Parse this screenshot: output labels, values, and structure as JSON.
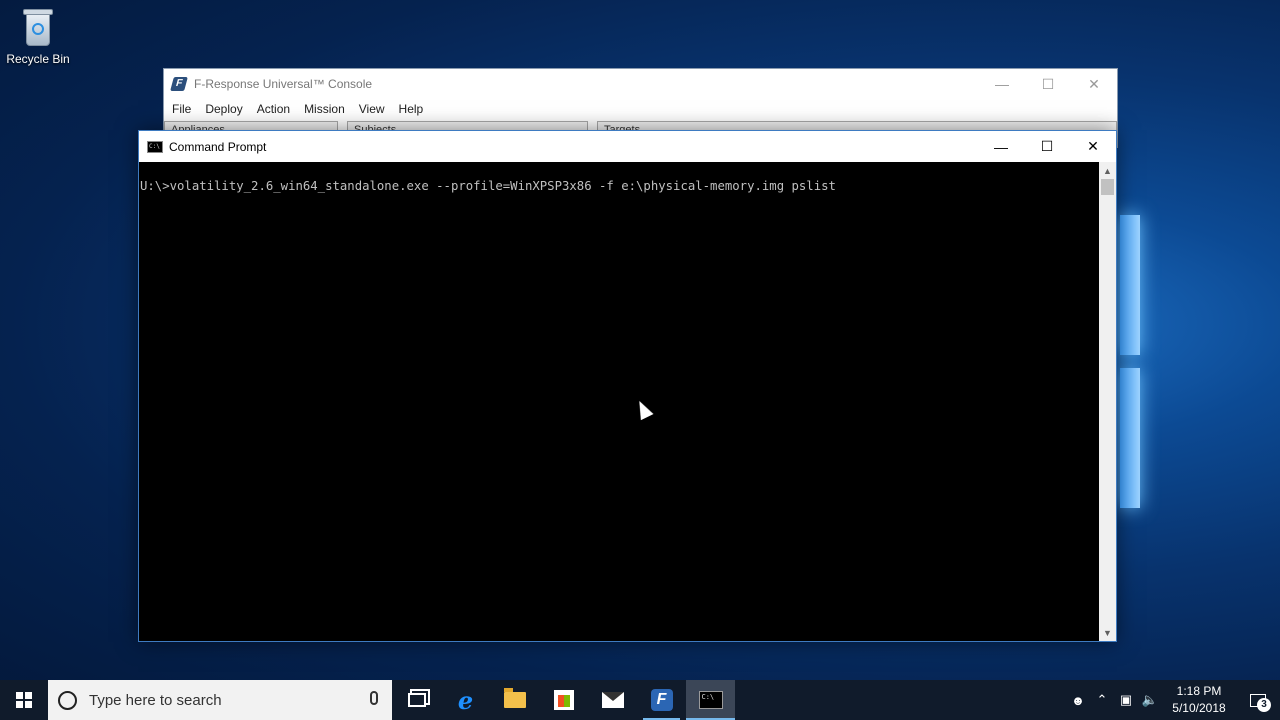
{
  "desktop": {
    "icons": [
      {
        "label": "Recycle Bin",
        "icon": "recycle-bin-icon"
      }
    ]
  },
  "fresponse": {
    "title": "F-Response Universal™ Console",
    "menu": [
      "File",
      "Deploy",
      "Action",
      "Mission",
      "View",
      "Help"
    ],
    "panels": [
      "Appliances",
      "Subjects",
      "Targets"
    ]
  },
  "cmd": {
    "title": "Command Prompt",
    "command_line": "U:\\>volatility_2.6_win64_standalone.exe --profile=WinXPSP3x86 -f e:\\physical-memory.img pslist"
  },
  "taskbar": {
    "search_placeholder": "Type here to search",
    "apps": [
      "task-view",
      "edge",
      "file-explorer",
      "store",
      "mail",
      "f-response",
      "command-prompt"
    ],
    "clock_time": "1:18 PM",
    "clock_date": "5/10/2018",
    "notification_count": "3"
  },
  "colors": {
    "taskbar": "#101b2b",
    "accent": "#76b9ed",
    "console_text": "#c0c0c0"
  }
}
